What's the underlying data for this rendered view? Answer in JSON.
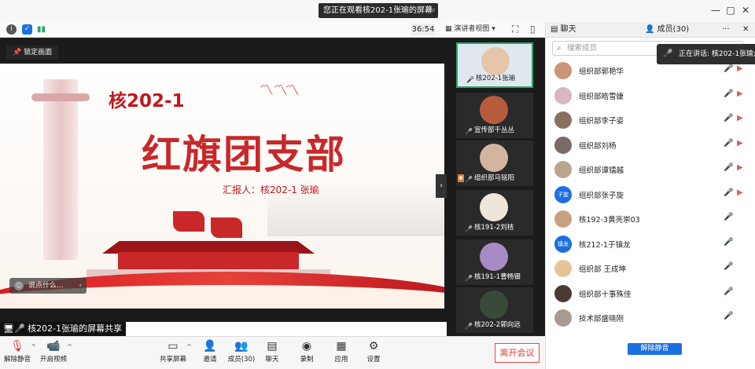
{
  "window": {
    "banner": "您正在观看核202-1张瑜的屏幕",
    "banner_action": "▭",
    "minimize": "—",
    "maximize": "□",
    "close": "✕"
  },
  "toolbar_top": {
    "timer": "36:54",
    "view_select": "演讲者视图"
  },
  "stage": {
    "pin_label": "锁定画面",
    "slide": {
      "core_title": "核202-1",
      "main_title": "红旗团支部",
      "reporter": "汇报人：核202-1 张瑜"
    },
    "comment_placeholder": "说点什么...",
    "share_label": "核202-1张瑜的屏幕共享"
  },
  "video_strip": [
    {
      "name": "核202-1张瑜",
      "active": true
    },
    {
      "name": "宣传部千丛丛",
      "active": false
    },
    {
      "name": "组织部马铭阳",
      "active": false
    },
    {
      "name": "核191-2刘桔",
      "active": false
    },
    {
      "name": "核191-1曹畅钿",
      "active": false
    },
    {
      "name": "核202-2郭向远",
      "active": false
    }
  ],
  "right_panel": {
    "tab_chat": "聊天",
    "tab_members": "成员(30)",
    "more": "···",
    "close": "✕",
    "search_placeholder": "搜索成员",
    "speaking_banner": "正在讲话: 核202-1张瑜;",
    "members": [
      {
        "name": "组织部郭艳华",
        "avatar": ""
      },
      {
        "name": "组织部皓雪婕",
        "avatar": ""
      },
      {
        "name": "组织部李子姿",
        "avatar": ""
      },
      {
        "name": "组织部刘杨",
        "avatar": ""
      },
      {
        "name": "组织部谭镭越",
        "avatar": ""
      },
      {
        "name": "组织部张子旋",
        "avatar": "子旋"
      },
      {
        "name": "核192-3黄亮崇03",
        "avatar": ""
      },
      {
        "name": "核212-1于镇龙",
        "avatar": "镇龙"
      },
      {
        "name": "组织部 王成坤",
        "avatar": ""
      },
      {
        "name": "组织部十事殊佳",
        "avatar": ""
      },
      {
        "name": "技术部盛晓刚",
        "avatar": ""
      }
    ],
    "unmute_all": "解除静音"
  },
  "bottom_toolbar": {
    "unmute": "解除静音",
    "video": "开启视频",
    "share": "共享屏幕",
    "invite": "邀请",
    "members": "成员(30)",
    "chat": "聊天",
    "record": "录制",
    "apps": "应用",
    "settings": "设置",
    "leave": "离开会议"
  },
  "colors": {
    "accent_blue": "#1c6fe0",
    "active_green": "#2aa36b",
    "leave_red": "#e33333",
    "slide_red": "#c8282a"
  }
}
